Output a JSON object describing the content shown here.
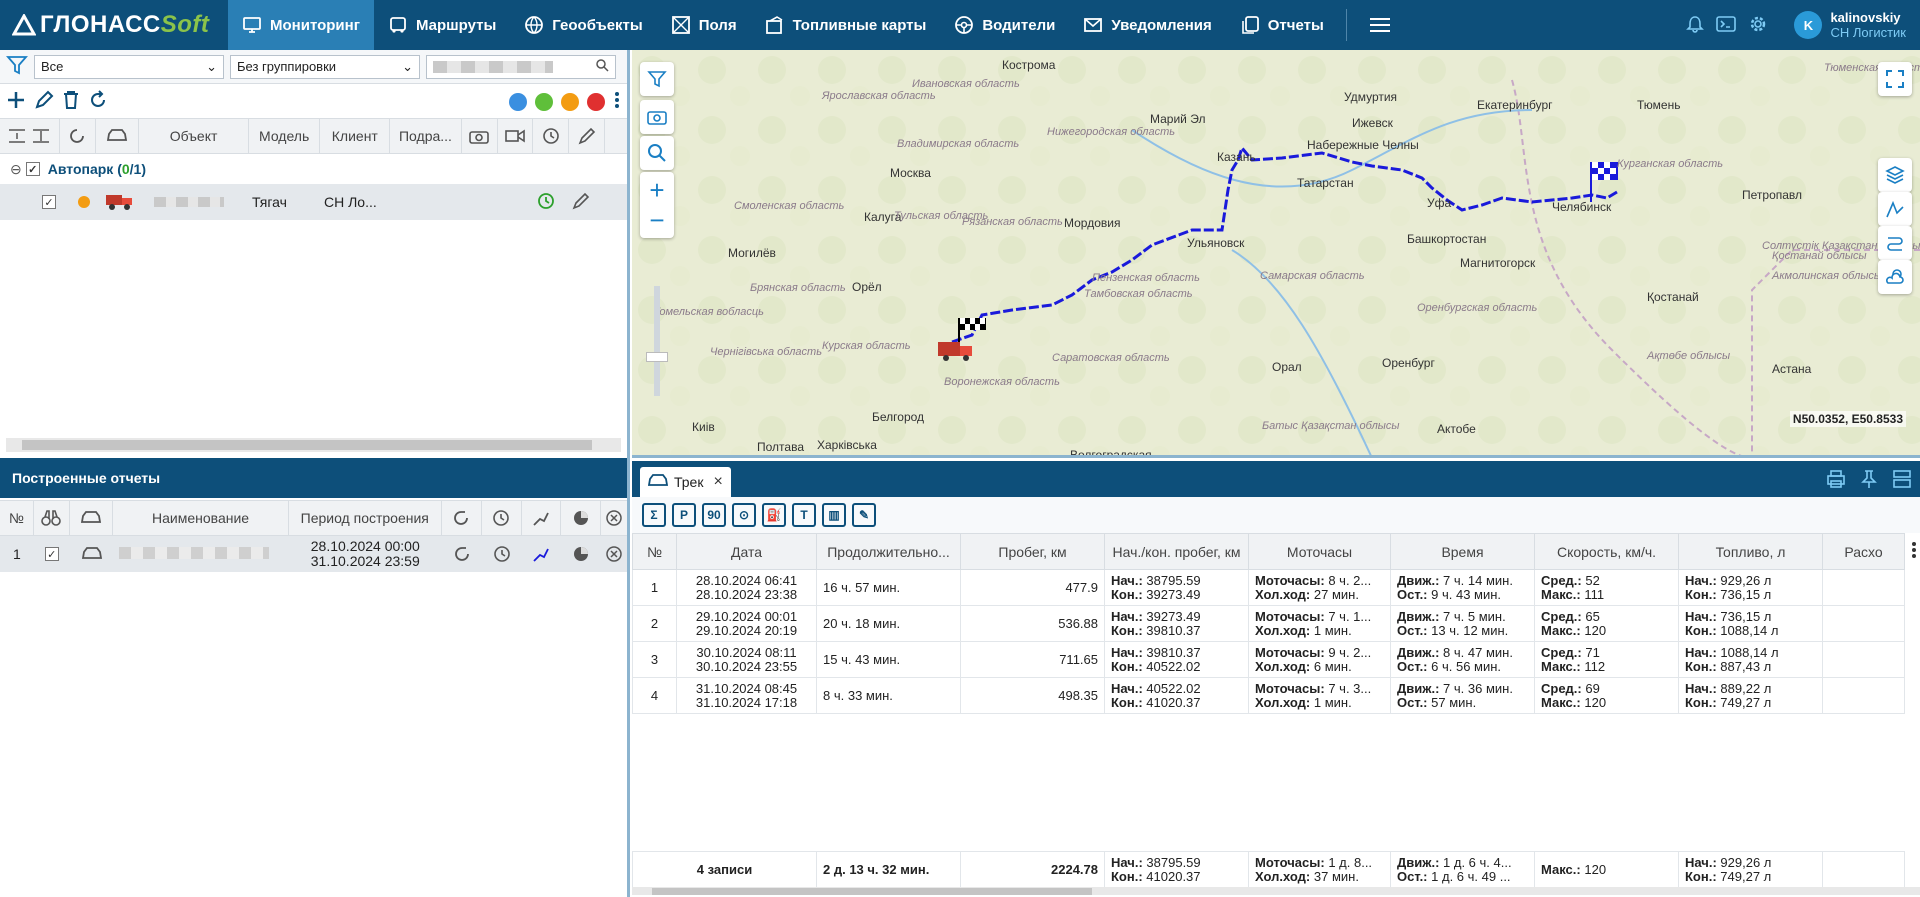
{
  "app": {
    "logo_main": "ГЛОНАСС",
    "logo_soft": "Soft"
  },
  "nav": [
    {
      "label": "Мониторинг",
      "icon": "monitor-icon",
      "active": true
    },
    {
      "label": "Маршруты",
      "icon": "bus-icon"
    },
    {
      "label": "Геообъекты",
      "icon": "globe-icon"
    },
    {
      "label": "Поля",
      "icon": "field-icon"
    },
    {
      "label": "Топливные карты",
      "icon": "fuel-card-icon"
    },
    {
      "label": "Водители",
      "icon": "steering-wheel-icon"
    },
    {
      "label": "Уведомления",
      "icon": "mail-icon"
    },
    {
      "label": "Отчеты",
      "icon": "reports-icon"
    }
  ],
  "user": {
    "initial": "K",
    "name": "kalinovskiy",
    "org": "СН Логистик"
  },
  "filters": {
    "type": "Все",
    "grouping": "Без группировки"
  },
  "objects_table": {
    "columns": [
      "Объект",
      "Модель",
      "Клиент",
      "Подра..."
    ],
    "group": {
      "name": "Автопарк",
      "open": "(",
      "count": "0",
      "sep": "/",
      "total": "1",
      "close": ")"
    },
    "row": {
      "model": "Тягач",
      "client": "СН Ло..."
    }
  },
  "reports_panel": {
    "title": "Построенные отчеты",
    "columns": {
      "num": "№",
      "name": "Наименование",
      "period": "Период построения"
    },
    "row": {
      "num": "1",
      "period_from": "28.10.2024 00:00",
      "period_to": "31.10.2024 23:59"
    }
  },
  "map": {
    "coords": "N50.0352, E50.8533",
    "labels": [
      {
        "t": "Кострома"
      },
      {
        "t": "Ивановская область"
      },
      {
        "t": "Ярославская область"
      },
      {
        "t": "Москва"
      },
      {
        "t": "Владимирская область"
      },
      {
        "t": "Нижегородская область"
      },
      {
        "t": "Марий Эл"
      },
      {
        "t": "Удмуртия"
      },
      {
        "t": "Ижевск"
      },
      {
        "t": "Екатеринбург"
      },
      {
        "t": "Тюмень"
      },
      {
        "t": "Казань"
      },
      {
        "t": "Набережные Челны"
      },
      {
        "t": "Татарстан"
      },
      {
        "t": "Калуга"
      },
      {
        "t": "Тульская область"
      },
      {
        "t": "Рязанская область"
      },
      {
        "t": "Мордовия"
      },
      {
        "t": "Ульяновск"
      },
      {
        "t": "Уфа"
      },
      {
        "t": "Челябинск"
      },
      {
        "t": "Башкортостан"
      },
      {
        "t": "Магнитогорск"
      },
      {
        "t": "Курганская область"
      },
      {
        "t": "Петропавл"
      },
      {
        "t": "Орёл"
      },
      {
        "t": "Пензенская область"
      },
      {
        "t": "Самарская область"
      },
      {
        "t": "Смоленская область"
      },
      {
        "t": "Тамбовская область"
      },
      {
        "t": "Курская область"
      },
      {
        "t": "Воронежская область"
      },
      {
        "t": "Белгород"
      },
      {
        "t": "Саратовская область"
      },
      {
        "t": "Орал"
      },
      {
        "t": "Оренбург"
      },
      {
        "t": "Оренбургская область"
      },
      {
        "t": "Қостанай"
      },
      {
        "t": "Астана"
      },
      {
        "t": "Актобе"
      },
      {
        "t": "Батыс Қазақстан облысы"
      },
      {
        "t": "Полтава"
      },
      {
        "t": "Харківська"
      },
      {
        "t": "Волгоградская"
      },
      {
        "t": "Киів"
      },
      {
        "t": "Чернігівська область"
      },
      {
        "t": "Гомельская вобласць"
      },
      {
        "t": "Брянская область"
      },
      {
        "t": "Могилёв"
      },
      {
        "t": "Тюменская область"
      },
      {
        "t": "Солтүстік Қазақстан облысы"
      },
      {
        "t": "Қостанай облысы"
      },
      {
        "t": "Акмолинская облысы"
      },
      {
        "t": "Ақтөбе облысы"
      }
    ]
  },
  "track_tab": {
    "label": "Трек"
  },
  "tools": [
    "Σ",
    "P",
    "90",
    "⊙",
    "⛽",
    "T",
    "▥",
    "✎"
  ],
  "report_table": {
    "columns": [
      "№",
      "Дата",
      "Продолжительно...",
      "Пробег, км",
      "Нач./кон. пробег, км",
      "Моточасы",
      "Время",
      "Скорость, км/ч.",
      "Топливо, л",
      "Расхо"
    ],
    "labels": {
      "start": "Нач.:",
      "end": "Кон.:",
      "moto": "Моточасы:",
      "idle": "Хол.ход:",
      "move": "Движ.:",
      "stop": "Ост.:",
      "avg": "Сред.:",
      "max": "Макс.:"
    },
    "rows": [
      {
        "n": "1",
        "d1": "28.10.2024 06:41",
        "d2": "28.10.2024 23:38",
        "dur": "16 ч. 57 мин.",
        "km": "477.9",
        "s": "38795.59",
        "e": "39273.49",
        "moto": "8 ч. 2...",
        "idle": "27 мин.",
        "move": "7 ч. 14 мин.",
        "stop": "9 ч. 43 мин.",
        "avg": "52",
        "max": "111",
        "fs": "929,26 л",
        "fe": "736,15 л"
      },
      {
        "n": "2",
        "d1": "29.10.2024 00:01",
        "d2": "29.10.2024 20:19",
        "dur": "20 ч. 18 мин.",
        "km": "536.88",
        "s": "39273.49",
        "e": "39810.37",
        "moto": "7 ч. 1...",
        "idle": "1 мин.",
        "move": "7 ч. 5 мин.",
        "stop": "13 ч. 12 мин.",
        "avg": "65",
        "max": "120",
        "fs": "736,15 л",
        "fe": "1088,14 л"
      },
      {
        "n": "3",
        "d1": "30.10.2024 08:11",
        "d2": "30.10.2024 23:55",
        "dur": "15 ч. 43 мин.",
        "km": "711.65",
        "s": "39810.37",
        "e": "40522.02",
        "moto": "9 ч. 2...",
        "idle": "6 мин.",
        "move": "8 ч. 47 мин.",
        "stop": "6 ч. 56 мин.",
        "avg": "71",
        "max": "112",
        "fs": "1088,14 л",
        "fe": "887,43 л"
      },
      {
        "n": "4",
        "d1": "31.10.2024 08:45",
        "d2": "31.10.2024 17:18",
        "dur": "8 ч. 33 мин.",
        "km": "498.35",
        "s": "40522.02",
        "e": "41020.37",
        "moto": "7 ч. 3...",
        "idle": "1 мин.",
        "move": "7 ч. 36 мин.",
        "stop": "57 мин.",
        "avg": "69",
        "max": "120",
        "fs": "889,22 л",
        "fe": "749,27 л"
      }
    ],
    "total": {
      "count": "4 записи",
      "dur": "2 д. 13 ч. 32 мин.",
      "km": "2224.78",
      "s": "38795.59",
      "e": "41020.37",
      "moto": "1 д. 8...",
      "idle": "37 мин.",
      "move": "1 д. 6 ч. 4...",
      "stop": "1 д. 6 ч. 49 ...",
      "max": "120",
      "fs": "929,26 л",
      "fe": "749,27 л"
    }
  },
  "colors": {
    "header": "#0d4f7a",
    "active": "#2a7fb5",
    "track": "#1a1adb",
    "accent_green": "#8bc34a"
  }
}
